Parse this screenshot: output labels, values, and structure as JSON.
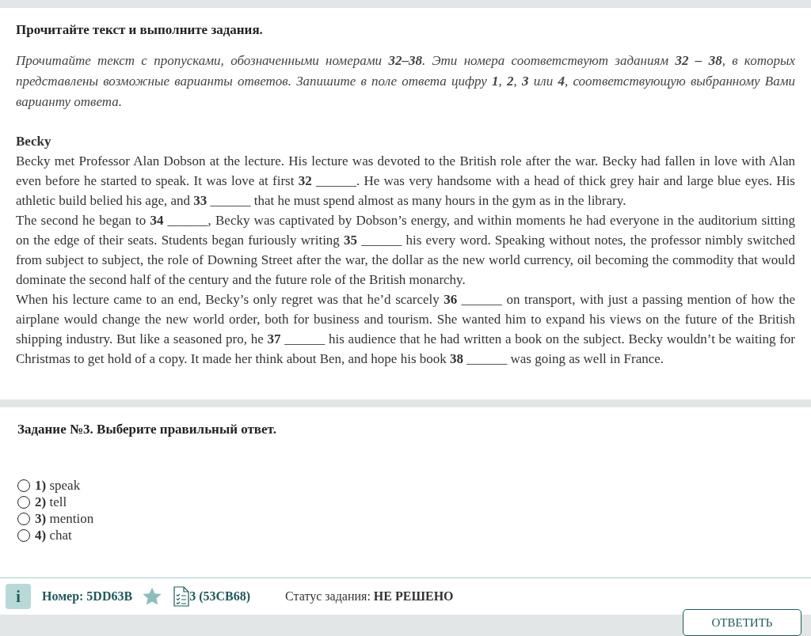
{
  "task_header": "Прочитайте текст и выполните задания.",
  "instruction": "Прочитайте текст с пропусками, обозначенными номерами **32–38**. Эти номера соответствуют заданиям **32 – 38**, в которых представлены возможные варианты ответов. Запишите в поле ответа цифру **1**, **2**, **3**  или **4**, соответствующую выбранному Вами варианту ответа.",
  "passage": {
    "title": "Becky",
    "paragraphs": [
      "Becky met Professor Alan Dobson at the lecture. His lecture was devoted to the British role after the war. Becky had fallen in love with Alan even before he started to speak. It was love at first **32** ______. He was very handsome with a head of thick grey hair and large blue eyes. His athletic build belied his age, and **33** ______ that he must spend almost as many hours in the gym as in the library.",
      "The second he began to  **34** ______, Becky was captivated by Dobson’s energy, and within moments he had everyone in the auditorium sitting on the edge of their seats. Students began furiously writing **35** ______ his every word. Speaking without notes, the professor nimbly switched from subject to subject, the role of Downing Street after the war, the dollar as the new world currency, oil becoming the commodity that would dominate the second half of the century and the future role of the British monarchy.",
      "When his lecture came to an end, Becky’s only regret was that he’d scarcely  **36** ______ on transport, with just a passing mention of how the airplane would change the new world order, both for business and tourism. She wanted him to expand his views on the future of the British shipping industry. But like a seasoned pro, he **37** ______ his audience that he had written a book on the subject. Becky wouldn’t be waiting for Christmas to get hold of a copy. It made her think about Ben, and hope his book **38** ______ was going as well in France."
    ]
  },
  "question": {
    "title": "Задание №3. Выберите правильный ответ.",
    "options": [
      {
        "label": "**1)** speak",
        "selected": false
      },
      {
        "label": "**2)** tell",
        "selected": false
      },
      {
        "label": "**3)** mention",
        "selected": false
      },
      {
        "label": "**4)** chat",
        "selected": false
      }
    ]
  },
  "footer": {
    "info_button": "i",
    "number": "Номер: 5DD63B",
    "variant": "3 (53CB68)",
    "status": "Статус задания: **НЕ РЕШЕНО**",
    "answer_button": "ОТВЕТИТЬ"
  }
}
